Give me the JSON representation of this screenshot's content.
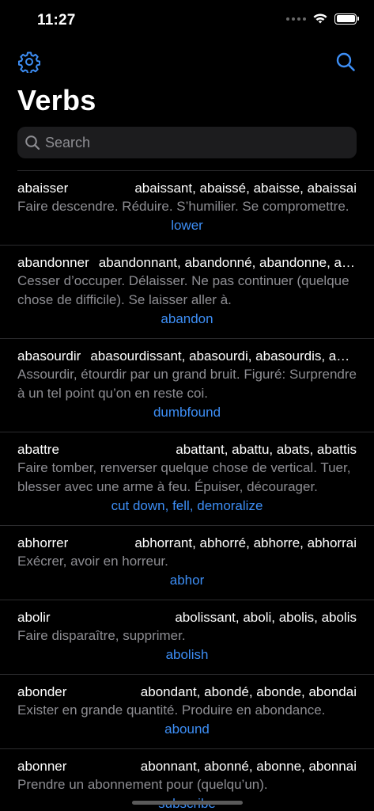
{
  "status": {
    "time": "11:27"
  },
  "nav": {
    "title": "Verbs"
  },
  "search": {
    "placeholder": "Search"
  },
  "colors": {
    "accent": "#3d8ef5",
    "secondary_text": "#8e8e93",
    "background": "#000000"
  },
  "verbs": [
    {
      "verb": "abaisser",
      "forms": "abaissant, abaissé, abaisse, abaissai",
      "definition": "Faire descendre. Réduire. S’humilier. Se compromettre.",
      "translation": "lower"
    },
    {
      "verb": "abandonner",
      "forms": "abandonnant, abandonné, abandonne, abandonnai",
      "definition": "Cesser d’occuper. Délaisser. Ne pas continuer (quelque chose de difficile). Se laisser aller à.",
      "translation": "abandon"
    },
    {
      "verb": "abasourdir",
      "forms": "abasourdissant, abasourdi, abasourdis, abasourdis",
      "definition": "Assourdir, étourdir par un grand bruit. Figuré: Surprendre à un tel point qu’on en reste coi.",
      "translation": "dumbfound"
    },
    {
      "verb": "abattre",
      "forms": "abattant, abattu, abats, abattis",
      "definition": "Faire tomber, renverser quelque chose de vertical. Tuer, blesser avec une arme à feu. Épuiser, décourager.",
      "translation": "cut down, fell, demoralize"
    },
    {
      "verb": "abhorrer",
      "forms": "abhorrant, abhorré, abhorre, abhorrai",
      "definition": "Exécrer, avoir en horreur.",
      "translation": "abhor"
    },
    {
      "verb": "abolir",
      "forms": "abolissant, aboli, abolis, abolis",
      "definition": "Faire disparaître, supprimer.",
      "translation": "abolish"
    },
    {
      "verb": "abonder",
      "forms": "abondant, abondé, abonde, abondai",
      "definition": "Exister en grande quantité. Produire en abondance.",
      "translation": "abound"
    },
    {
      "verb": "abonner",
      "forms": "abonnant, abonné, abonne, abonnai",
      "definition": "Prendre un abonnement pour (quelqu’un).",
      "translation": "subscribe"
    }
  ]
}
